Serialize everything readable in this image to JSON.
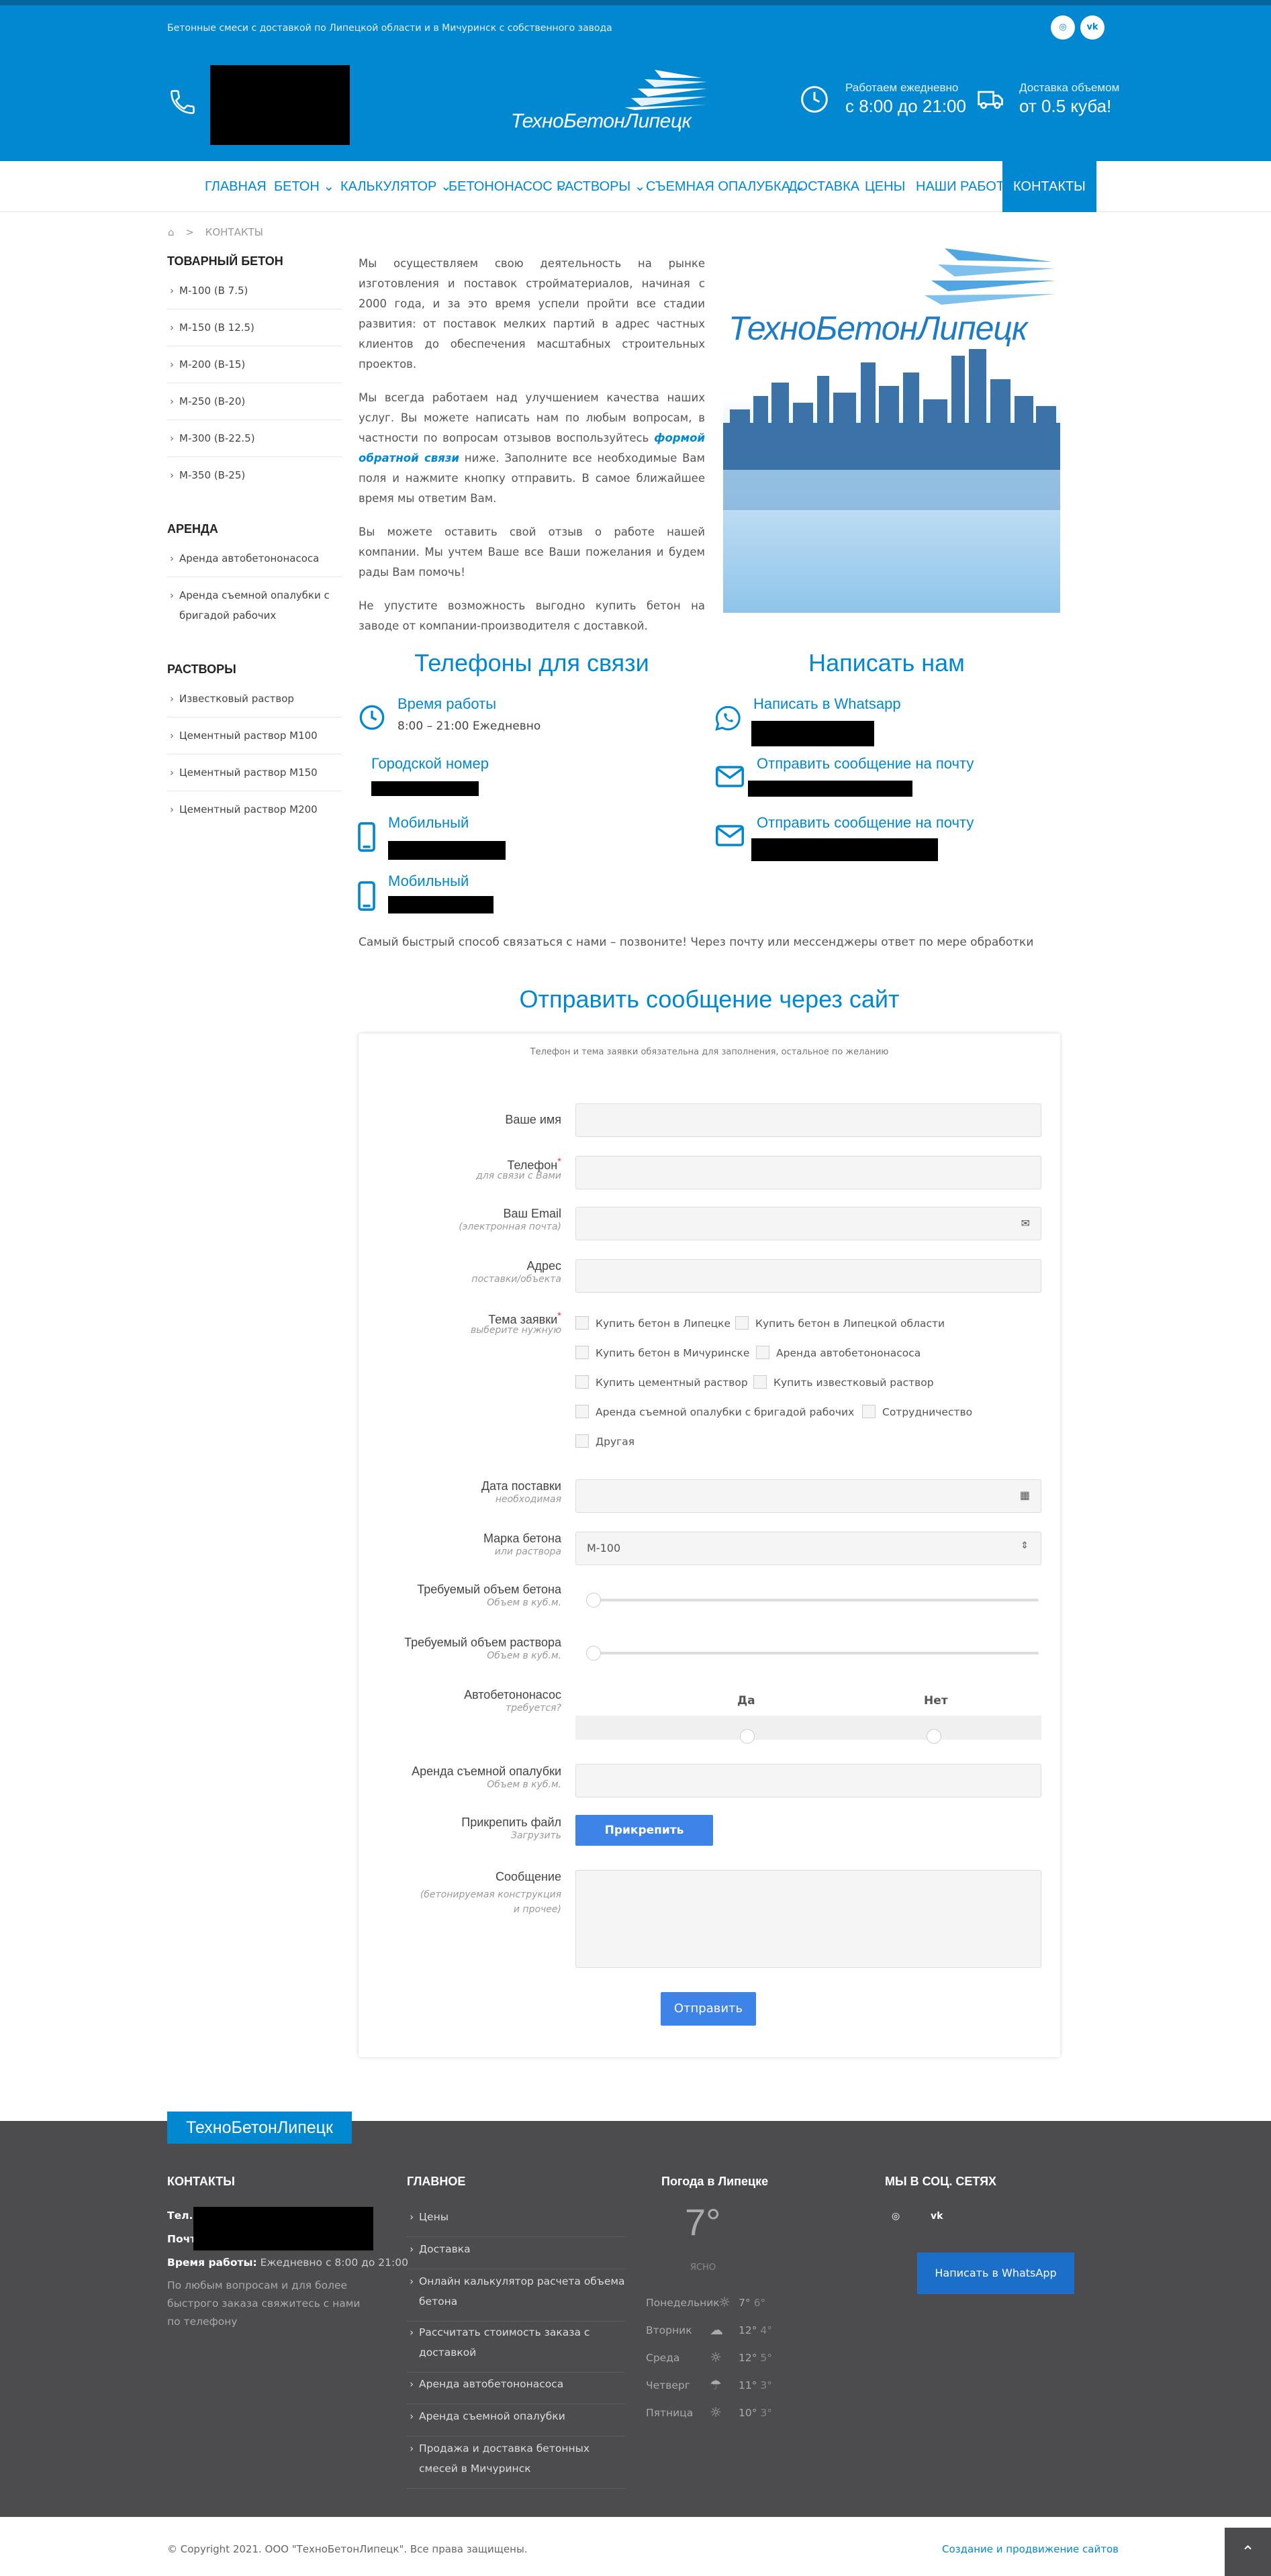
{
  "topbar": {
    "tagline": "Бетонные смеси с доставкой по Липецкой области и в Мичуринск с собственного завода",
    "social": [
      {
        "icon": "instagram-icon",
        "glyph": "◎"
      },
      {
        "icon": "vk-icon",
        "glyph": "vk"
      }
    ]
  },
  "header": {
    "logo_text": "ТехноБетонЛипецк",
    "hours_small": "Работаем ежедневно",
    "hours_big": "с 8:00 до 21:00",
    "delivery_small": "Доставка объемом",
    "delivery_big": "от 0.5 куба!"
  },
  "nav": [
    {
      "label": "ГЛАВНАЯ",
      "caret": ""
    },
    {
      "label": "БЕТОН",
      "caret": "⌄"
    },
    {
      "label": "КАЛЬКУЛЯТОР",
      "caret": "⌄"
    },
    {
      "label": "БЕТОНОНАСОС",
      "caret": "⌄"
    },
    {
      "label": "РАСТВОРЫ",
      "caret": "⌄"
    },
    {
      "label": "СЪЕМНАЯ ОПАЛУБКА",
      "caret": "⌄"
    },
    {
      "label": "ДОСТАВКА",
      "caret": ""
    },
    {
      "label": "ЦЕНЫ",
      "caret": ""
    },
    {
      "label": "НАШИ РАБОТЫ",
      "caret": ""
    },
    {
      "label": "КОНТАКТЫ",
      "caret": ""
    }
  ],
  "breadcrumb": {
    "home_icon": "home-icon",
    "sep": ">",
    "current": "КОНТАКТЫ"
  },
  "sidebar": {
    "concrete_title": "ТОВАРНЫЙ БЕТОН",
    "concrete": [
      "М-100 (В 7.5)",
      "М-150 (В 12.5)",
      "М-200 (В-15)",
      "М-250 (В-20)",
      "М-300 (В-22.5)",
      "М-350 (В-25)"
    ],
    "rent_title": "АРЕНДА",
    "rent": [
      "Аренда автобетононасоса",
      "Аренда съемной опалубки с бригадой рабочих"
    ],
    "mortar_title": "РАСТВОРЫ",
    "mortar": [
      "Известковый раствор",
      "Цементный раствор М100",
      "Цементный раствор М150",
      "Цементный раствор М200"
    ]
  },
  "intro": {
    "p1": "Мы осуществляем свою деятельность на рынке изготовления и поставок стройматериалов, начиная с 2000 года, и за это время успели пройти все стадии развития: от поставок мелких партий в адрес частных клиентов до обеспечения масштабных строительных проектов.",
    "p2_before": "Мы всегда работаем над улучшением качества наших услуг. Вы можете написать нам по любым вопросам, в частности по вопросам отзывов воспользуйтесь ",
    "p2_link": "формой обратной связи",
    "p2_after": " ниже. Заполните все необходимые Вам поля и нажмите кнопку отправить. В самое ближайшее время мы ответим Вам.",
    "p3": "Вы можете оставить свой отзыв о работе нашей компании. Мы учтем Ваше все Ваши пожелания и будем рады Вам помочь!",
    "p4": "Не упустите возможность выгодно купить бетон на заводе от компании-производителя с доставкой."
  },
  "image_logo_text": "ТехноБетонЛипецк",
  "contacts": {
    "phones_title": "Телефоны для связи",
    "write_title": "Написать нам",
    "work_time_label": "Время работы",
    "work_time_value": "8:00 – 21:00 Ежедневно",
    "city_label": "Городской номер",
    "mobile1_label": "Мобильный",
    "mobile2_label": "Мобильный",
    "whatsapp_label": "Написать в Whatsapp",
    "mail1_label": "Отправить сообщение на почту",
    "mail2_label": "Отправить сообщение на почту",
    "note": "Самый быстрый способ связаться с нами – позвоните! Через почту или мессенджеры ответ по мере обработки"
  },
  "form": {
    "title": "Отправить сообщение через сайт",
    "hint": "Телефон и тема заявки обязательна для заполнения, остальное по желанию",
    "name_label": "Ваше имя",
    "phone_label": "Телефон",
    "phone_sub": "для связи с Вами",
    "required_mark": "*",
    "email_label": "Ваш Email",
    "email_sub": "(электронная почта)",
    "address_label": "Адрес",
    "address_sub": "поставки/объекта",
    "topic_label": "Тема заявки",
    "topic_sub": "выберите нужную",
    "topics": [
      "Купить бетон в Липецке",
      "Купить бетон в Липецкой области",
      "Купить бетон в Мичуринске",
      "Аренда автобетононасоса",
      "Купить цементный раствор",
      "Купить известковый раствор",
      "Аренда съемной опалубки с бригадой рабочих",
      "Сотрудничество",
      "Другая"
    ],
    "date_label": "Дата поставки",
    "date_sub": "необходимая",
    "grade_label": "Марка бетона",
    "grade_sub": "или раствора",
    "grade_value": "М-100",
    "vol_concrete_label": "Требуемый объем бетона",
    "vol_concrete_sub": "Объем в куб.м.",
    "vol_mortar_label": "Требуемый объем раствора",
    "vol_mortar_sub": "Объем в куб.м.",
    "pump_label": "Автобетононасос",
    "pump_sub": "требуется?",
    "pump_yes": "Да",
    "pump_no": "Нет",
    "formwork_label": "Аренда съемной опалубки",
    "formwork_sub": "Объем в куб.м.",
    "file_label": "Прикрепить файл",
    "file_sub": "Загрузить",
    "file_btn": "Прикрепить",
    "msg_label": "Сообщение",
    "msg_sub": "(бетонируемая конструкция и прочее)",
    "submit": "Отправить"
  },
  "footer": {
    "logo": "ТехноБетонЛипецк",
    "contacts_title": "КОНТАКТЫ",
    "tel_label": "Тел.:",
    "mail_label": "Почта:",
    "hours_label": "Время работы:",
    "hours_value": "Ежедневно с 8:00 до 21:00",
    "promo": "По любым вопросам и для более быстрого заказа свяжитесь с нами по телефону",
    "main_title": "ГЛАВНОЕ",
    "links": [
      "Цены",
      "Доставка",
      "Онлайн калькулятор расчета объема бетона",
      "Рассчитать стоимость заказа с доставкой",
      "Аренда автобетононасоса",
      "Аренда съемной опалубки",
      "Продажа и доставка бетонных смесей в Мичуринск"
    ],
    "weather_title": "Погода в Липецке",
    "weather_now": "7°",
    "weather_state": "ЯСНО",
    "weather": [
      {
        "day": "Понедельник",
        "hi": "7°",
        "lo": "6°",
        "icon": "sun-icon"
      },
      {
        "day": "Вторник",
        "hi": "12°",
        "lo": "4°",
        "icon": "cloud-icon"
      },
      {
        "day": "Среда",
        "hi": "12°",
        "lo": "5°",
        "icon": "sun-icon"
      },
      {
        "day": "Четверг",
        "hi": "11°",
        "lo": "3°",
        "icon": "rain-icon"
      },
      {
        "day": "Пятница",
        "hi": "10°",
        "lo": "3°",
        "icon": "sun-icon"
      }
    ],
    "social_title": "МЫ В СОЦ. СЕТЯХ",
    "social": [
      {
        "icon": "instagram-icon",
        "glyph": "◎"
      },
      {
        "icon": "vk-icon",
        "glyph": "vk"
      }
    ],
    "whatsapp_btn": "Написать в WhatsApp"
  },
  "bottom": {
    "copyright": "© Copyright 2021. ООО \"ТехноБетонЛипецк\". Все права защищены.",
    "made": "Создание и продвижение сайтов",
    "totop": "⌃"
  }
}
